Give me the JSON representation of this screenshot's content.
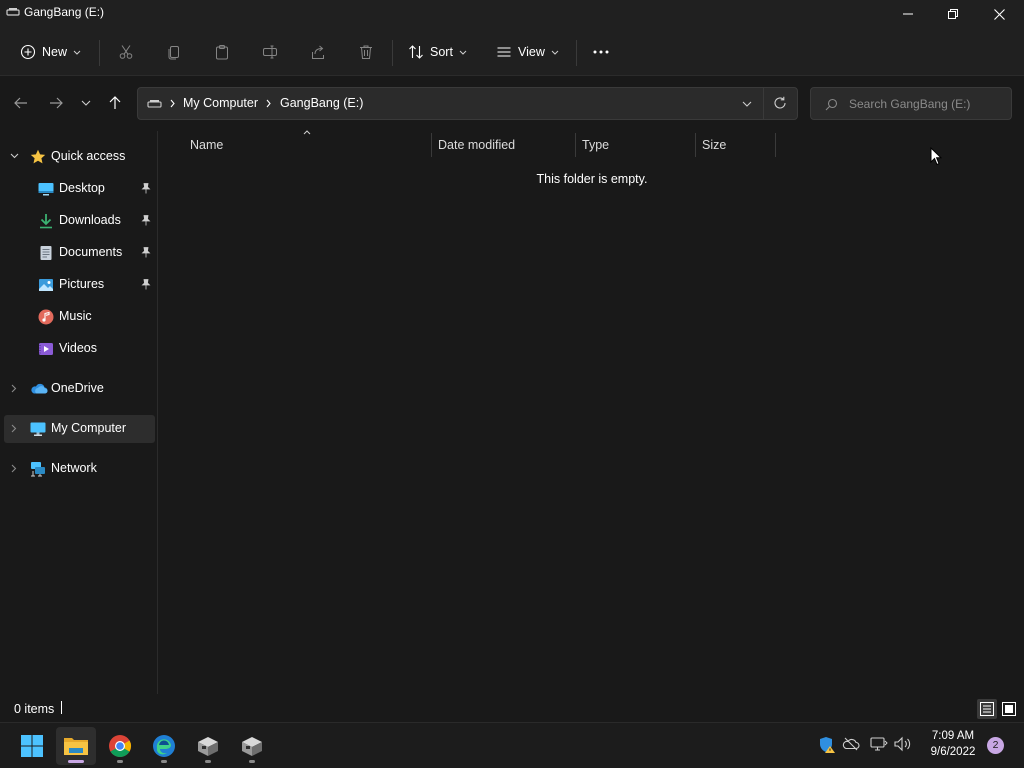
{
  "window": {
    "title": "GangBang (E:)"
  },
  "toolbar": {
    "new_label": "New",
    "sort_label": "Sort",
    "view_label": "View",
    "icons": [
      "new-icon",
      "cut-icon",
      "copy-icon",
      "paste-icon",
      "rename-icon",
      "share-icon",
      "delete-icon",
      "sort-icon",
      "view-icon",
      "more-icon"
    ]
  },
  "address": {
    "breadcrumbs": [
      "My Computer",
      "GangBang (E:)"
    ],
    "search_placeholder": "Search GangBang (E:)"
  },
  "sidebar": {
    "items": [
      {
        "label": "Quick access",
        "icon": "star-icon"
      },
      {
        "label": "Desktop",
        "icon": "desktop-icon",
        "pinned": true
      },
      {
        "label": "Downloads",
        "icon": "downloads-icon",
        "pinned": true
      },
      {
        "label": "Documents",
        "icon": "documents-icon",
        "pinned": true
      },
      {
        "label": "Pictures",
        "icon": "pictures-icon",
        "pinned": true
      },
      {
        "label": "Music",
        "icon": "music-icon"
      },
      {
        "label": "Videos",
        "icon": "videos-icon"
      },
      {
        "label": "OneDrive",
        "icon": "onedrive-icon"
      },
      {
        "label": "My Computer",
        "icon": "computer-icon",
        "selected": true
      },
      {
        "label": "Network",
        "icon": "network-icon"
      }
    ]
  },
  "content": {
    "columns": [
      "Name",
      "Date modified",
      "Type",
      "Size"
    ],
    "empty_message": "This folder is empty."
  },
  "status": {
    "item_count": "0 items"
  },
  "taskbar": {
    "apps": [
      "windows-start-icon",
      "file-explorer-icon",
      "chrome-icon",
      "edge-icon",
      "app-box-icon",
      "app-box-icon"
    ],
    "time": "7:09 AM",
    "date": "9/6/2022",
    "notification_count": "2"
  },
  "colors": {
    "background": "#191919",
    "chrome": "#202020",
    "accent": "#4cc2ff",
    "folder_yellow": "#f6c343",
    "notification_badge": "#c8a7e4"
  }
}
